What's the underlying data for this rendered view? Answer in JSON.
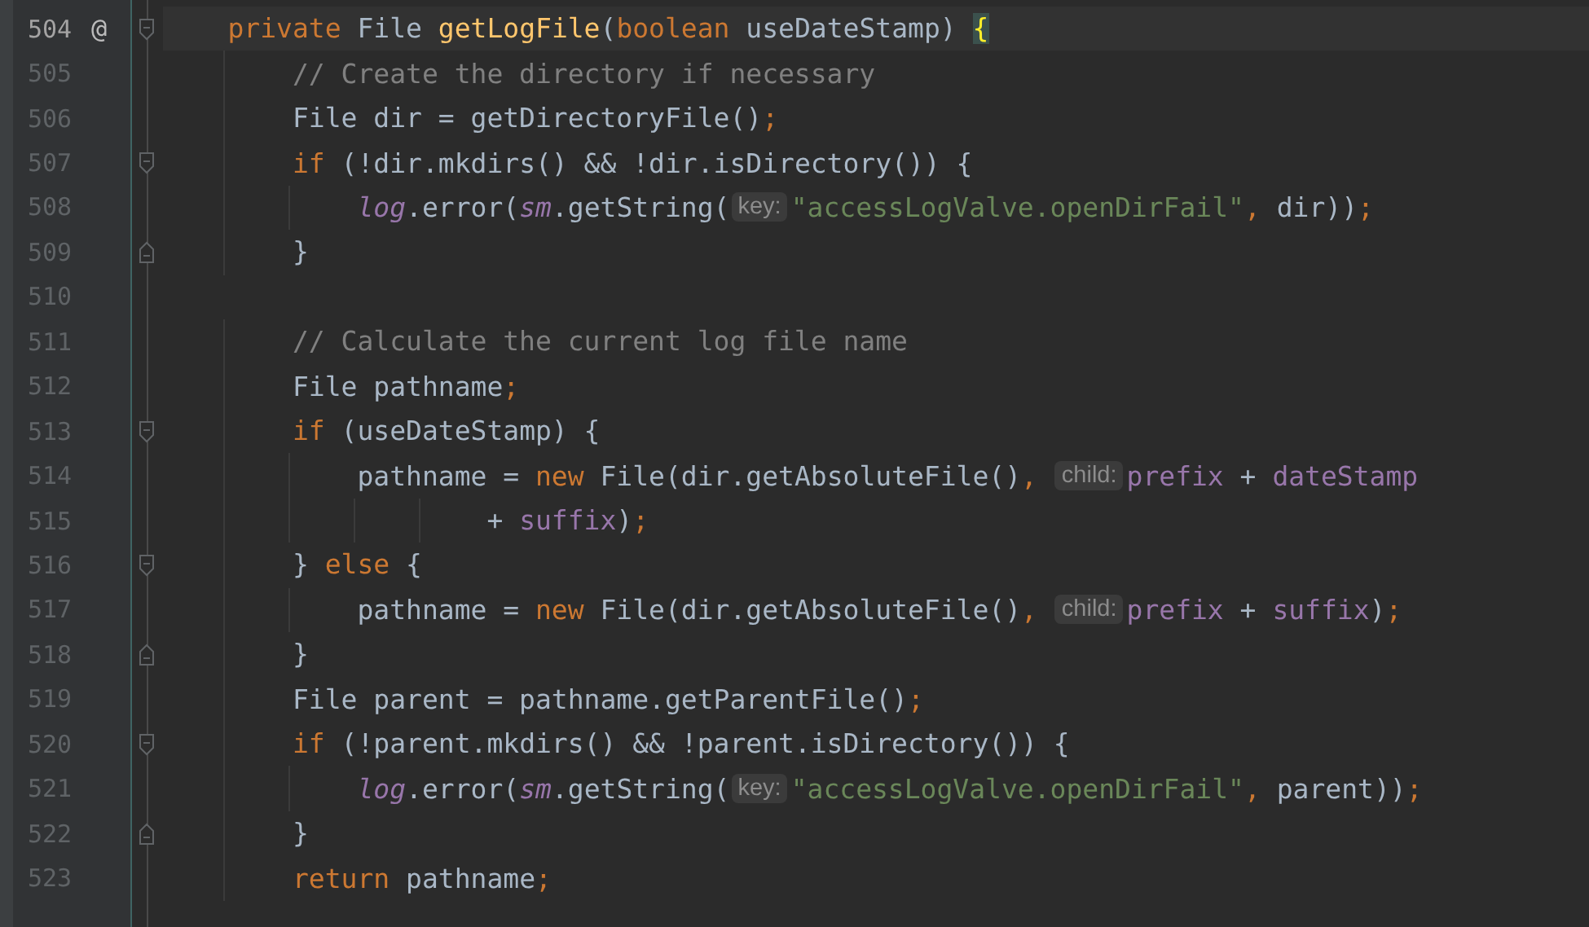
{
  "editor": {
    "lines": [
      {
        "number": "504",
        "current": true,
        "marker": "@",
        "fold": {
          "kind": "start"
        },
        "tokens": [
          {
            "kind": "keyword",
            "text": "    private"
          },
          {
            "kind": "plain",
            "text": " File "
          },
          {
            "kind": "declaration",
            "text": "getLogFile"
          },
          {
            "kind": "plain",
            "text": "("
          },
          {
            "kind": "keyword",
            "text": "boolean"
          },
          {
            "kind": "plain",
            "text": " useDateStamp) "
          },
          {
            "kind": "brace_match",
            "text": "{"
          }
        ]
      },
      {
        "number": "505",
        "current": false,
        "tokens": [
          {
            "kind": "comment",
            "text": "        // Create the directory if necessary"
          }
        ]
      },
      {
        "number": "506",
        "current": false,
        "tokens": [
          {
            "kind": "plain",
            "text": "        File dir = getDirectoryFile()"
          },
          {
            "kind": "punct",
            "text": ";"
          }
        ]
      },
      {
        "number": "507",
        "current": false,
        "fold": {
          "kind": "start"
        },
        "tokens": [
          {
            "kind": "keyword",
            "text": "        if"
          },
          {
            "kind": "plain",
            "text": " (!dir.mkdirs() && !dir.isDirectory()) {"
          }
        ]
      },
      {
        "number": "508",
        "current": false,
        "tokens": [
          {
            "kind": "static",
            "text": "            log"
          },
          {
            "kind": "plain",
            "text": ".error("
          },
          {
            "kind": "static",
            "text": "sm"
          },
          {
            "kind": "plain",
            "text": ".getString("
          },
          {
            "kind": "hint",
            "text": "key:"
          },
          {
            "kind": "string",
            "text": "\"accessLogValve.openDirFail\""
          },
          {
            "kind": "punct",
            "text": ","
          },
          {
            "kind": "plain",
            "text": " dir))"
          },
          {
            "kind": "punct",
            "text": ";"
          }
        ]
      },
      {
        "number": "509",
        "current": false,
        "fold": {
          "kind": "end"
        },
        "tokens": [
          {
            "kind": "plain",
            "text": "        }"
          }
        ]
      },
      {
        "number": "510",
        "current": false
      },
      {
        "number": "511",
        "current": false,
        "tokens": [
          {
            "kind": "comment",
            "text": "        // Calculate the current log file name"
          }
        ]
      },
      {
        "number": "512",
        "current": false,
        "tokens": [
          {
            "kind": "plain",
            "text": "        File pathname"
          },
          {
            "kind": "punct",
            "text": ";"
          }
        ]
      },
      {
        "number": "513",
        "current": false,
        "fold": {
          "kind": "start"
        },
        "tokens": [
          {
            "kind": "keyword",
            "text": "        if"
          },
          {
            "kind": "plain",
            "text": " (useDateStamp) {"
          }
        ]
      },
      {
        "number": "514",
        "current": false,
        "tokens": [
          {
            "kind": "plain",
            "text": "            pathname = "
          },
          {
            "kind": "keyword",
            "text": "new"
          },
          {
            "kind": "plain",
            "text": " File(dir.getAbsoluteFile()"
          },
          {
            "kind": "punct",
            "text": ", "
          },
          {
            "kind": "hint",
            "text": "child:"
          },
          {
            "kind": "field",
            "text": "prefix"
          },
          {
            "kind": "plain",
            "text": " + "
          },
          {
            "kind": "field",
            "text": "dateStamp"
          }
        ]
      },
      {
        "number": "515",
        "current": false,
        "tokens": [
          {
            "kind": "plain",
            "text": "                    + "
          },
          {
            "kind": "field",
            "text": "suffix"
          },
          {
            "kind": "plain",
            "text": ")"
          },
          {
            "kind": "punct",
            "text": ";"
          }
        ]
      },
      {
        "number": "516",
        "current": false,
        "fold": {
          "kind": "start"
        },
        "tokens": [
          {
            "kind": "plain",
            "text": "        } "
          },
          {
            "kind": "keyword",
            "text": "else"
          },
          {
            "kind": "plain",
            "text": " {"
          }
        ]
      },
      {
        "number": "517",
        "current": false,
        "tokens": [
          {
            "kind": "plain",
            "text": "            pathname = "
          },
          {
            "kind": "keyword",
            "text": "new"
          },
          {
            "kind": "plain",
            "text": " File(dir.getAbsoluteFile()"
          },
          {
            "kind": "punct",
            "text": ", "
          },
          {
            "kind": "hint",
            "text": "child:"
          },
          {
            "kind": "field",
            "text": "prefix"
          },
          {
            "kind": "plain",
            "text": " + "
          },
          {
            "kind": "field",
            "text": "suffix"
          },
          {
            "kind": "plain",
            "text": ")"
          },
          {
            "kind": "punct",
            "text": ";"
          }
        ]
      },
      {
        "number": "518",
        "current": false,
        "fold": {
          "kind": "end"
        },
        "tokens": [
          {
            "kind": "plain",
            "text": "        }"
          }
        ]
      },
      {
        "number": "519",
        "current": false,
        "tokens": [
          {
            "kind": "plain",
            "text": "        File parent = pathname.getParentFile()"
          },
          {
            "kind": "punct",
            "text": ";"
          }
        ]
      },
      {
        "number": "520",
        "current": false,
        "fold": {
          "kind": "start"
        },
        "tokens": [
          {
            "kind": "keyword",
            "text": "        if"
          },
          {
            "kind": "plain",
            "text": " (!parent.mkdirs() && !parent.isDirectory()) {"
          }
        ]
      },
      {
        "number": "521",
        "current": false,
        "tokens": [
          {
            "kind": "static",
            "text": "            log"
          },
          {
            "kind": "plain",
            "text": ".error("
          },
          {
            "kind": "static",
            "text": "sm"
          },
          {
            "kind": "plain",
            "text": ".getString("
          },
          {
            "kind": "hint",
            "text": "key:"
          },
          {
            "kind": "string",
            "text": "\"accessLogValve.openDirFail\""
          },
          {
            "kind": "punct",
            "text": ","
          },
          {
            "kind": "plain",
            "text": " parent))"
          },
          {
            "kind": "punct",
            "text": ";"
          }
        ]
      },
      {
        "number": "522",
        "current": false,
        "fold": {
          "kind": "end"
        },
        "tokens": [
          {
            "kind": "plain",
            "text": "        }"
          }
        ]
      },
      {
        "number": "523",
        "current": false,
        "tokens": [
          {
            "kind": "keyword",
            "text": "        return"
          },
          {
            "kind": "plain",
            "text": " pathname"
          },
          {
            "kind": "punct",
            "text": ";"
          }
        ]
      }
    ]
  }
}
